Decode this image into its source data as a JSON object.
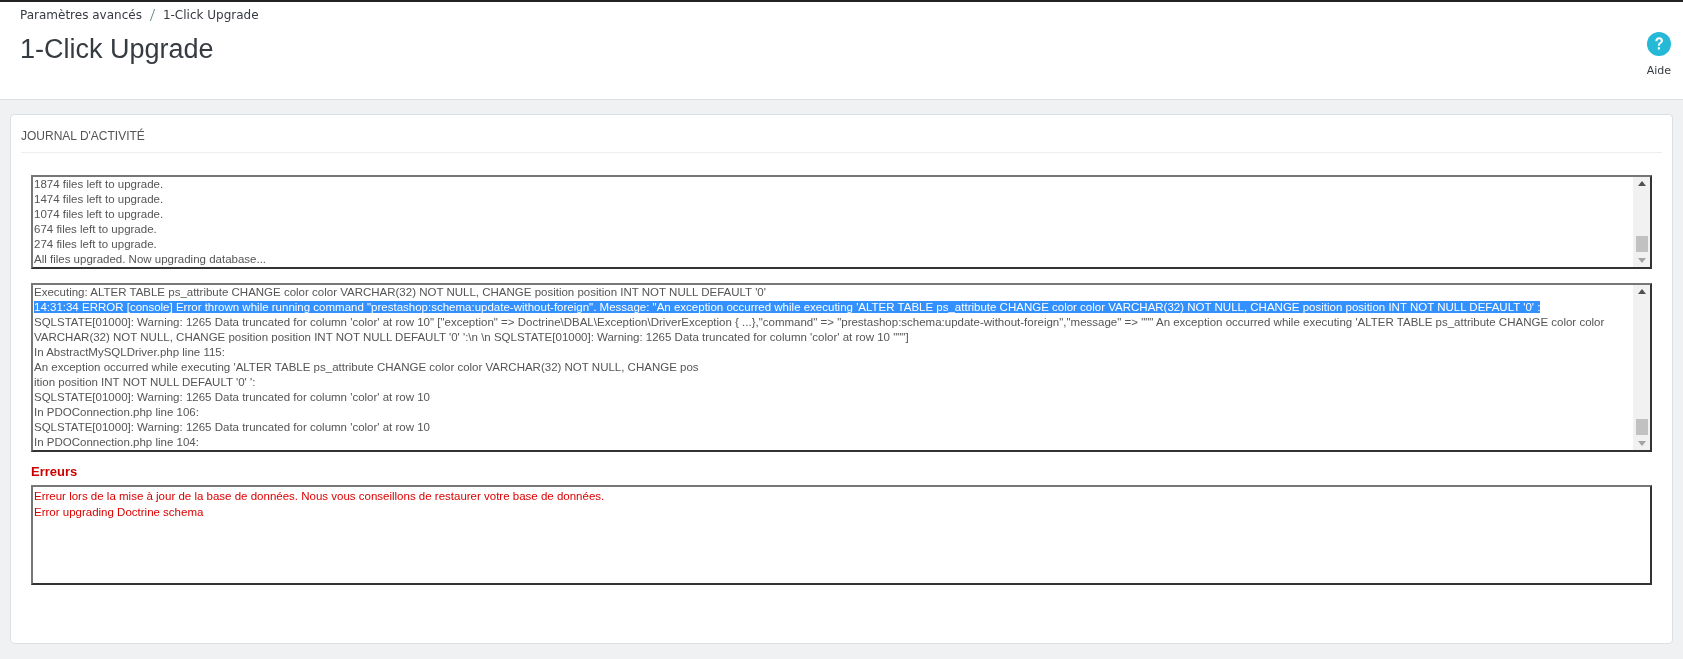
{
  "breadcrumb": [
    "Paramètres avancés",
    "1-Click Upgrade"
  ],
  "page_title": "1-Click Upgrade",
  "help": {
    "label": "Aide"
  },
  "panel": {
    "title": "JOURNAL D'ACTIVITÉ"
  },
  "progress_log": [
    {
      "text": "1874 files left to upgrade.",
      "selected": false
    },
    {
      "text": "1474 files left to upgrade.",
      "selected": false
    },
    {
      "text": "1074 files left to upgrade.",
      "selected": false
    },
    {
      "text": "674 files left to upgrade.",
      "selected": false
    },
    {
      "text": "274 files left to upgrade.",
      "selected": false
    },
    {
      "text": "All files upgraded. Now upgrading database...",
      "selected": false
    }
  ],
  "detail_log": [
    {
      "text": "Executing: ALTER TABLE ps_attribute CHANGE color color VARCHAR(32) NOT NULL, CHANGE position position INT NOT NULL DEFAULT '0'",
      "selected": false
    },
    {
      "text": "14:31:34 ERROR [console] Error thrown while running command \"prestashop:schema:update-without-foreign\". Message: \"An exception occurred while executing 'ALTER TABLE ps_attribute CHANGE color color VARCHAR(32) NOT NULL, CHANGE position position INT NOT NULL DEFAULT '0' :",
      "selected": true
    },
    {
      "text": "SQLSTATE[01000]: Warning: 1265 Data truncated for column 'color' at row 10\" [\"exception\" => Doctrine\\DBAL\\Exception\\DriverException { ...},\"command\" => \"prestashop:schema:update-without-foreign\",\"message\" => \"\"\" An exception occurred while executing 'ALTER TABLE ps_attribute CHANGE color color VARCHAR(32) NOT NULL, CHANGE position position INT NOT NULL DEFAULT '0' ':\\n \\n SQLSTATE[01000]: Warning: 1265 Data truncated for column 'color' at row 10 \"\"\"]",
      "selected": false
    },
    {
      "text": "In AbstractMySQLDriver.php line 115:",
      "selected": false
    },
    {
      "text": "An exception occurred while executing 'ALTER TABLE ps_attribute CHANGE color color VARCHAR(32) NOT NULL, CHANGE pos",
      "selected": false
    },
    {
      "text": "ition position INT NOT NULL DEFAULT '0' ':",
      "selected": false
    },
    {
      "text": "SQLSTATE[01000]: Warning: 1265 Data truncated for column 'color' at row 10",
      "selected": false
    },
    {
      "text": "In PDOConnection.php line 106:",
      "selected": false
    },
    {
      "text": "SQLSTATE[01000]: Warning: 1265 Data truncated for column 'color' at row 10",
      "selected": false
    },
    {
      "text": "In PDOConnection.php line 104:",
      "selected": false
    }
  ],
  "errors": {
    "title": "Erreurs",
    "lines": [
      "Erreur lors de la mise à jour de la base de données. Nous vous conseillons de restaurer votre base de données.",
      "Error upgrading Doctrine schema"
    ]
  }
}
